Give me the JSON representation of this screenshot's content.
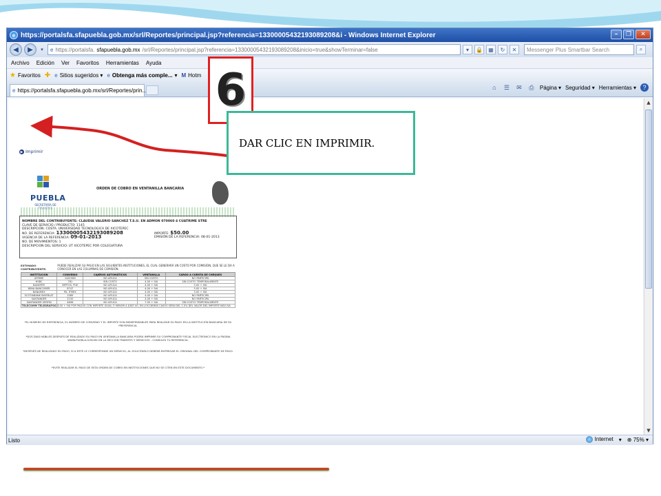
{
  "window": {
    "title": "https://portalsfa.sfapuebla.gob.mx/srl/Reportes/principal.jsp?referencia=13300005432193089208&i - Windows Internet Explorer"
  },
  "address": {
    "url_prefix": "https://portalsfa.",
    "url_host": "sfapuebla.gob.mx",
    "url_rest": "/srl/Reportes/principal.jsp?referencia=13300005432193089208&inicio=true&showTerminar=false",
    "search_placeholder": "Messenger Plus Smartbar Search"
  },
  "menu": [
    "Archivo",
    "Edición",
    "Ver",
    "Favoritos",
    "Herramientas",
    "Ayuda"
  ],
  "favorites": {
    "label": "Favoritos",
    "items": [
      "Sitios sugeridos ▾",
      "Obtenga más comple...",
      "Hotm"
    ]
  },
  "tab": {
    "label": "https://portalsfa.sfapuebla.gob.mx/srl/Reportes/prin..."
  },
  "commands": [
    "Página ▾",
    "Seguridad ▾",
    "Herramientas ▾"
  ],
  "status": {
    "text": "Listo",
    "zone": "Internet",
    "zoom": "75%"
  },
  "document": {
    "print_link": "Imprimir",
    "logo_word": "PUEBLA",
    "logo_sub": "SECRETARÍA DE FINANZAS",
    "title": "ORDEN DE COBRO EN VENTANILLA BANCARIA",
    "lines": [
      "NOMBRE DEL CONTRIBUYENTE: CLAUDIA VALERIO SANCHEZ T.S.U. EN ADMON 070060 4 CUATRIME STRE",
      "CLAVE DE SERVICIO / PRODUCTO: 1145",
      "DESCRIPCIÓN: COSTA. UNIVERSIDAD TECNOLOGICA DE XICOTEPEC"
    ],
    "ref_label": "NO. DE REFERENCIA:",
    "ref_value": "13300005432193089208",
    "vig_label": "VIGENCIA DE LA REFERENCIA:",
    "vig_value": "09-01-2013",
    "mov_line": "NO. DE MOVIMIENTOS: 1",
    "serv_line": "DESCRIPCION DEL SERVICIO: UT XICOTEPEC POR COLEGIATURA",
    "importe_label": "IMPORTE:",
    "importe_value": "$50.00",
    "emision_line": "EMISIÓN DE LA REFERENCIA: 08-01-2013",
    "estimado_label": "ESTIMADO CONTRIBUYENTE:",
    "estimado_text": "PUEDE REALIZAR SU PAGO EN LAS SIGUIENTES INSTITUCIONES, EL CUAL GENERARÁ UN COSTO POR COMISIÓN, QUE SE LE DA A CONOCER EN LAS COLUMNAS DE COMISIÓN.",
    "table_headers": [
      "INSTITUCIÓN",
      "CONVENIO",
      "CAJEROS AUTOMÁTICOS",
      "VENTANILLA",
      "CARGO A CUENTA DE CHEQUES"
    ],
    "table_rows": [
      [
        "AFIRME",
        "1441560",
        "NO APLICA",
        "SIN COSTO",
        "NO PARTICIPA"
      ],
      [
        "HSBC",
        "781",
        "SIN COSTO",
        "4.00 + IVA",
        "SIN COSTO TEMPORALMENTE"
      ],
      [
        "BANORTE",
        "IMPTOS. PUE",
        "NO APLICA",
        "4.00 + IVA",
        "3.00 + IVA"
      ],
      [
        "BBVA BANCOMER",
        "8747",
        "NO APLICA",
        "4.00 + IVA",
        "3.00 + IVA"
      ],
      [
        "BANAMEX",
        "PA. ITMEX",
        "NO APLICA",
        "4.00 + IVA",
        "3.00 + IVA"
      ],
      [
        "SCOTIABANK INVERLAT",
        "1089",
        "NO APLICA",
        "4.00 + IVA",
        "NO PARTICIPA"
      ],
      [
        "SANTANDER",
        "2150",
        "NO APLICA",
        "4.00 + IVA",
        "NO PARTICIPA"
      ],
      [
        "SANTANDER SERFIN",
        "4896",
        "NO APLICA",
        "7.00 + IVA",
        "SIN COSTO TEMPORALMENTE"
      ]
    ],
    "telecomm_label": "TELECOMM TELEGRAFOS",
    "telecomm_text": "8.00 + IVA POR PAGOS CON IMPORTE IGUAL O MENOR A $387.00, EN LOS DEMÁS CASOS SERÁ DEL 1.5% DEL VALOR DEL IMPORTE MÁS IVA",
    "notes": [
      "*EL NÚMERO DE REFERENCIA, EL NÚMERO DE CONVENIO Y EL IMPORTE SON INDISPENSABLES PARA REALIZAR SU PAGO EN LA INSTITUCIÓN BANCARIA DE SU PREFERENCIA.",
      "*DOS DÍAS HÁBILES DESPUÉS DE REALIZADO SU PAGO EN VENTANILLA BANCARIA PODRÁ IMPRIMIR SU COMPROBANTE FISCAL ELECTRÓNICO EN LA PÁGINA WWW.PUEBLA.GOB.MX EN LA SECCIÓN TRÁMITES Y SERVICIOS - CONSULTA TU REFERENCIA.",
      "*DESPUÉS DE REALIZADO SU PAGO, SI A ESTE LE CORRESPONDE UN SERVICIO, AL SOLICITARLO DEBERÁ ENTREGAR EL ORIGINAL DEL COMPROBANTE DE PAGO.",
      "*EVITE REALIZAR EL PAGO DE ESTA ORDEN DE COBRO EN INSTITUCIONES QUE NO SE CITEN EN ESTE DOCUMENTO.*"
    ]
  },
  "annotation": {
    "step_number": "6",
    "callout_text": "DAR CLIC EN IMPRIMIR."
  },
  "colors": {
    "badge_border": "#e02020",
    "callout_border": "#3cb898",
    "arrow": "#d42020",
    "footer_line": "#c04a28"
  }
}
